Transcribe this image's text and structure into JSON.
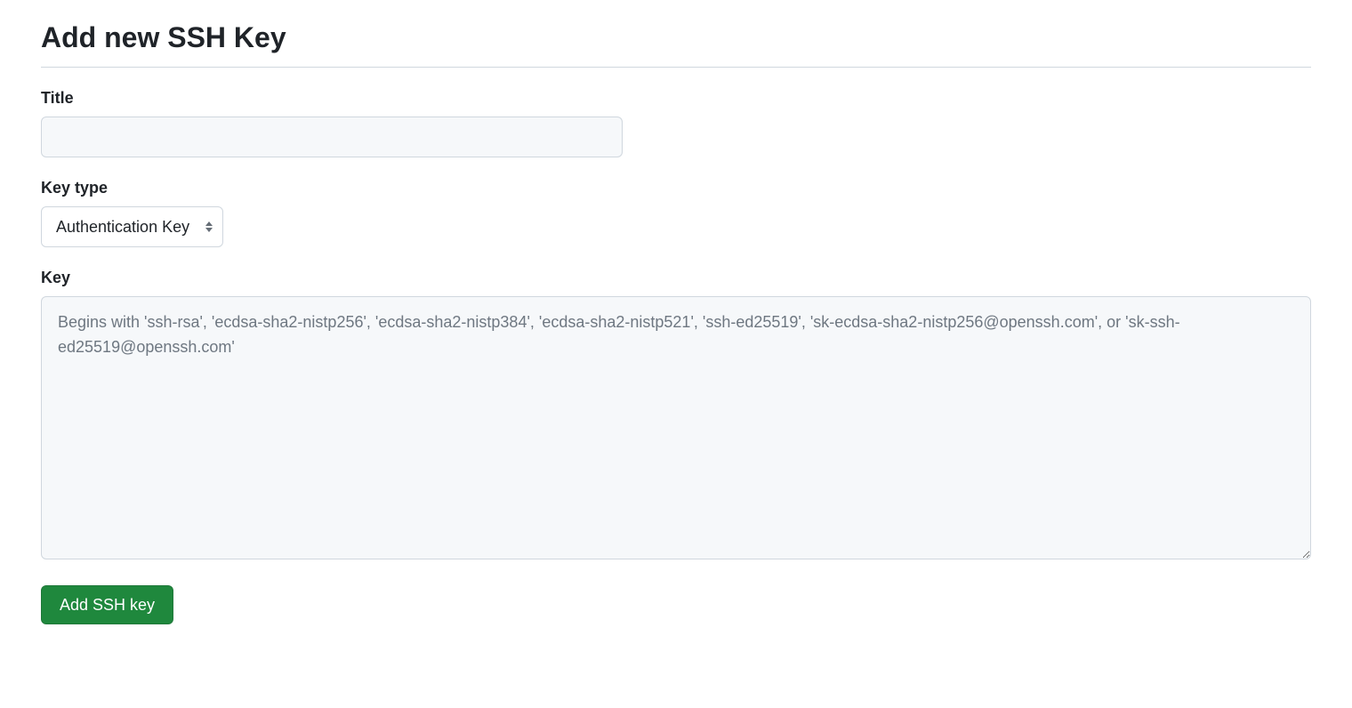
{
  "page": {
    "title": "Add new SSH Key"
  },
  "form": {
    "title": {
      "label": "Title",
      "value": ""
    },
    "key_type": {
      "label": "Key type",
      "selected": "Authentication Key"
    },
    "key": {
      "label": "Key",
      "placeholder": "Begins with 'ssh-rsa', 'ecdsa-sha2-nistp256', 'ecdsa-sha2-nistp384', 'ecdsa-sha2-nistp521', 'ssh-ed25519', 'sk-ecdsa-sha2-nistp256@openssh.com', or 'sk-ssh-ed25519@openssh.com'",
      "value": ""
    },
    "submit_label": "Add SSH key"
  }
}
